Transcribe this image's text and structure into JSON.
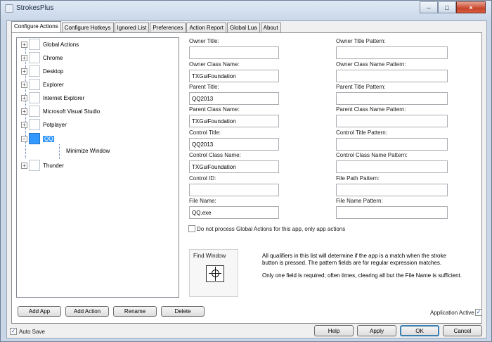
{
  "window": {
    "title": "StrokesPlus"
  },
  "tabs": [
    {
      "label": "Configure Actions"
    },
    {
      "label": "Configure Hotkeys"
    },
    {
      "label": "Ignored List"
    },
    {
      "label": "Preferences"
    },
    {
      "label": "Action Report"
    },
    {
      "label": "Global Lua"
    },
    {
      "label": "About"
    }
  ],
  "tree": {
    "items": [
      {
        "label": "Global Actions",
        "expander": "+"
      },
      {
        "label": "Chrome",
        "expander": "+"
      },
      {
        "label": "Desktop",
        "expander": "+"
      },
      {
        "label": "Explorer",
        "expander": "+"
      },
      {
        "label": "Internet Explorer",
        "expander": "+"
      },
      {
        "label": "Microsoft Visual Studio",
        "expander": "+"
      },
      {
        "label": "Potplayer",
        "expander": "+"
      },
      {
        "label": "QQ",
        "expander": "−"
      },
      {
        "label": "Thunder",
        "expander": "+"
      }
    ],
    "child": {
      "label": "Minimize Window"
    }
  },
  "tree_buttons": {
    "add_app": "Add App",
    "add_action": "Add Action",
    "rename": "Rename",
    "delete": "Delete"
  },
  "fields": {
    "owner_title": {
      "label": "Owner Title:",
      "value": ""
    },
    "owner_title_pattern": {
      "label": "Owner Title Pattern:",
      "value": ""
    },
    "owner_class": {
      "label": "Owner Class Name:",
      "value": "TXGuiFoundation"
    },
    "owner_class_pattern": {
      "label": "Owner Class Name Pattern:",
      "value": ""
    },
    "parent_title": {
      "label": "Parent Title:",
      "value": "QQ2013"
    },
    "parent_title_pattern": {
      "label": "Parent Title Pattern:",
      "value": ""
    },
    "parent_class": {
      "label": "Parent Class Name:",
      "value": "TXGuiFoundation"
    },
    "parent_class_pattern": {
      "label": "Parent Class Name Pattern:",
      "value": ""
    },
    "control_title": {
      "label": "Control Title:",
      "value": "QQ2013"
    },
    "control_title_pattern": {
      "label": "Control Title Pattern:",
      "value": ""
    },
    "control_class": {
      "label": "Control Class Name:",
      "value": "TXGuiFoundation"
    },
    "control_class_pattern": {
      "label": "Control Class Name Pattern:",
      "value": ""
    },
    "control_id": {
      "label": "Control ID:",
      "value": ""
    },
    "file_path_pattern": {
      "label": "File Path Pattern:",
      "value": ""
    },
    "file_name": {
      "label": "File Name:",
      "value": "QQ.exe"
    },
    "file_name_pattern": {
      "label": "File Name Pattern:",
      "value": ""
    }
  },
  "options": {
    "no_global_actions": {
      "label": "Do not process Global Actions for this app, only app actions",
      "checked": false
    },
    "app_active": {
      "label": "Application Active",
      "checked": true
    },
    "auto_save": {
      "label": "Auto Save",
      "checked": true
    }
  },
  "find_window": {
    "label": "Find Window"
  },
  "note": {
    "line1": "All qualifiers in this list will determine if the app is a match when the stroke button is pressed. The pattern fields are for regular expression matches.",
    "line2": "Only one field is required; often times, clearing all but the File Name is sufficient."
  },
  "dialog_buttons": {
    "help": "Help",
    "apply": "Apply",
    "ok": "OK",
    "cancel": "Cancel"
  },
  "colors": {
    "accent": "#3399ff",
    "border": "#828790"
  },
  "icons": {
    "tree_item": "window-icon",
    "finder": "crosshair-icon"
  }
}
